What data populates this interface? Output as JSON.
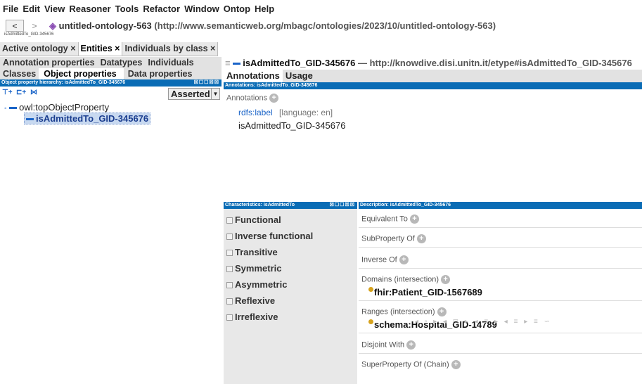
{
  "menu": [
    "File",
    "Edit",
    "View",
    "Reasoner",
    "Tools",
    "Refactor",
    "Window",
    "Ontop",
    "Help"
  ],
  "nav": {
    "back": "<",
    "forward": ">"
  },
  "ontology": {
    "title": "untitled-ontology-563",
    "uri": "(http://www.semanticweb.org/mbagc/ontologies/2023/10/untitled-ontology-563)"
  },
  "breadcrumb": "isAdmittedTo_GID-345676",
  "tabs": [
    "Active ontology ×",
    "Entities ×",
    "Individuals by class ×"
  ],
  "left": {
    "tabs_row1": [
      "Annotation properties",
      "Datatypes",
      "Individuals"
    ],
    "tabs_row2": [
      "Classes",
      "Object properties",
      "Data properties"
    ],
    "hierarchy_title": "Object property hierarchy: isAdmittedTo_GID-345676",
    "hierarchy_ctrls": "☒☐☐☒☒",
    "asserted": "Asserted",
    "root": "owl:topObjectProperty",
    "selected": "isAdmittedTo_GID-345676"
  },
  "right": {
    "header_name": "isAdmittedTo_GID-345676",
    "header_uri": "— http://knowdive.disi.unitn.it/etype#isAdmittedTo_GID-345676",
    "tabs": [
      "Annotations",
      "Usage"
    ],
    "annotations_bar": "Annotations: isAdmittedTo_GID-345676",
    "annotations_label": "Annotations",
    "rdfs_label": "rdfs:label",
    "language": "[language: en]",
    "label_value": "isAdmittedTo_GID-345676",
    "characteristics_bar": "Characteristics: isAdmittedTo",
    "description_bar": "Description: isAdmittedTo_GID-345676",
    "characteristics": [
      "Functional",
      "Inverse functional",
      "Transitive",
      "Symmetric",
      "Asymmetric",
      "Reflexive",
      "Irreflexive"
    ],
    "description": {
      "equivalent": "Equivalent To",
      "subproperty": "SubProperty Of",
      "inverse": "Inverse Of",
      "domains": "Domains (intersection)",
      "domain_value": "fhir:Patient_GID-1567689",
      "ranges": "Ranges (intersection)",
      "range_value": "schema:Hospital_GID-14789",
      "disjoint": "Disjoint With",
      "chain": "SuperProperty Of (Chain)"
    }
  },
  "colors": {
    "accent_blue": "#0a6cb5",
    "selection": "#c8d9f0",
    "object_prop": "#1a64c8",
    "class_dot": "#d6a21c"
  }
}
